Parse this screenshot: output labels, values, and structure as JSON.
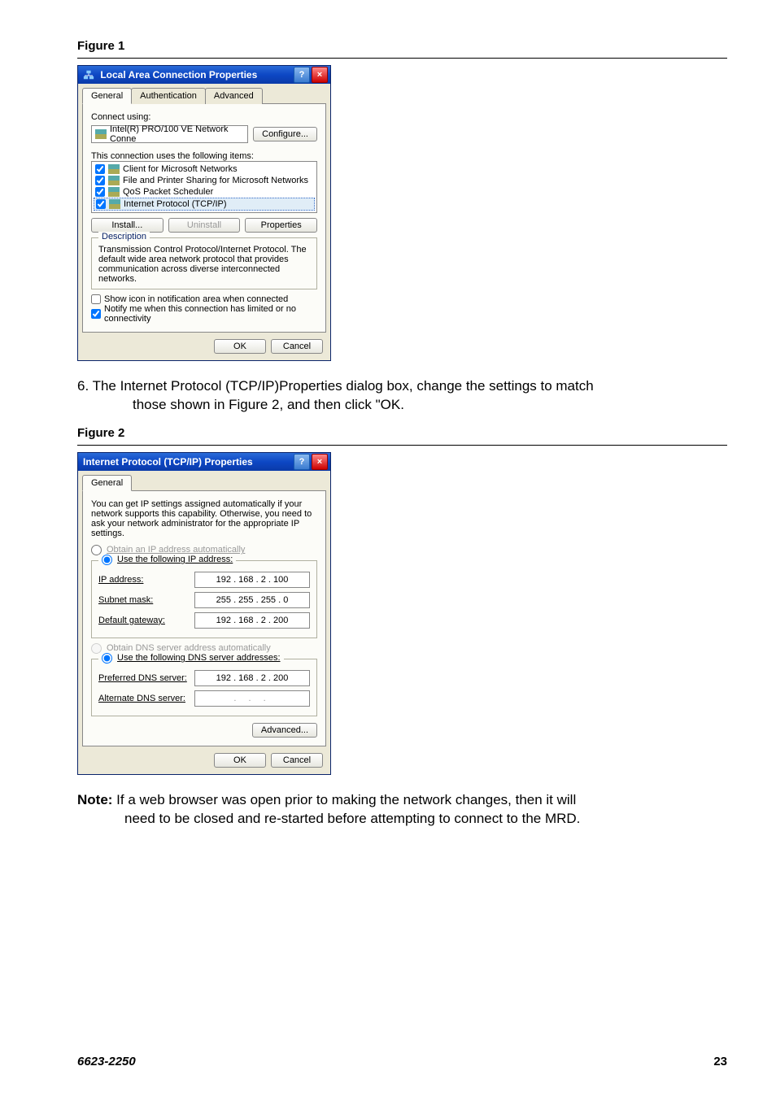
{
  "fig1_label": "Figure 1",
  "fig2_label": "Figure 2",
  "dlg1": {
    "title": "Local Area Connection Properties",
    "tabs": [
      "General",
      "Authentication",
      "Advanced"
    ],
    "connect_using": "Connect using:",
    "adapter": "Intel(R) PRO/100 VE Network Conne",
    "configure": "Configure...",
    "uses_items": "This connection uses the following items:",
    "items": [
      "Client for Microsoft Networks",
      "File and Printer Sharing for Microsoft Networks",
      "QoS Packet Scheduler",
      "Internet Protocol (TCP/IP)"
    ],
    "install": "Install...",
    "uninstall": "Uninstall",
    "properties": "Properties",
    "desc_title": "Description",
    "desc_text": "Transmission Control Protocol/Internet Protocol. The default wide area network protocol that provides communication across diverse interconnected networks.",
    "show_icon": "Show icon in notification area when connected",
    "notify": "Notify me when this connection has limited or no connectivity",
    "ok": "OK",
    "cancel": "Cancel"
  },
  "step6_a": "6. The Internet Protocol (TCP/IP)Properties dialog box, change the settings to match",
  "step6_b": "those shown in Figure 2, and then click \"OK.",
  "dlg2": {
    "title": "Internet Protocol (TCP/IP) Properties",
    "tab": "General",
    "help_text": "You can get IP settings assigned automatically if your network supports this capability. Otherwise, you need to ask your network administrator for the appropriate IP settings.",
    "r_obtain_ip": "Obtain an IP address automatically",
    "r_use_ip": "Use the following IP address:",
    "l_ip": "IP address:",
    "v_ip": "192 . 168 .   2  . 100",
    "l_mask": "Subnet mask:",
    "v_mask": "255 . 255 . 255 .   0",
    "l_gw": "Default gateway:",
    "v_gw": "192 . 168 .   2  . 200",
    "r_obtain_dns": "Obtain DNS server address automatically",
    "r_use_dns": "Use the following DNS server addresses:",
    "l_pdns": "Preferred DNS server:",
    "v_pdns": "192 . 168 .   2  . 200",
    "l_adns": "Alternate DNS server:",
    "advanced": "Advanced...",
    "ok": "OK",
    "cancel": "Cancel"
  },
  "note_bold": "Note:",
  "note_a": " If a web browser was open prior to making the network changes, then it will",
  "note_b": "need to be closed and re-started before attempting to connect to the MRD.",
  "doc_num": "6623-2250",
  "page_num": "23"
}
